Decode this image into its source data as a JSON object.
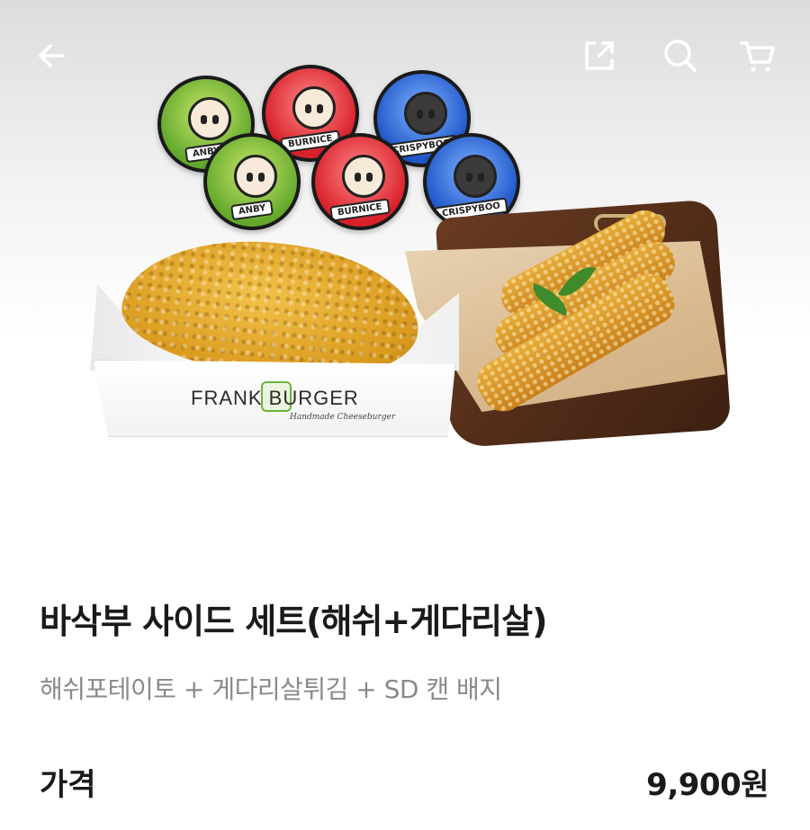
{
  "product": {
    "title": "바삭부 사이드 세트(해쉬+게다리살)",
    "description": "해쉬포테이토 + 게다리살튀김 + SD 캔 배지",
    "price_label": "가격",
    "price_value": "9,900원"
  },
  "image": {
    "brand_text": "FRANK  BURGER",
    "brand_subtext": "Handmade Cheeseburger",
    "badges": [
      {
        "label": "ANBY",
        "color": "green"
      },
      {
        "label": "BURNICE",
        "color": "red"
      },
      {
        "label": "CRISPYBOO",
        "color": "blue"
      },
      {
        "label": "ANBY",
        "color": "green"
      },
      {
        "label": "BURNICE",
        "color": "red"
      },
      {
        "label": "CRISPYBOO",
        "color": "blue"
      }
    ]
  },
  "icons": {
    "back": "arrow-left-icon",
    "share": "share-icon",
    "search": "search-icon",
    "cart": "cart-icon"
  },
  "colors": {
    "title": "#1a1a1a",
    "description": "#8a8a8a",
    "icon": "#ffffff"
  }
}
